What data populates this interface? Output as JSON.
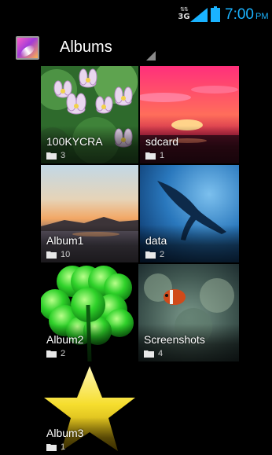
{
  "status_bar": {
    "network_type": "3G",
    "time": "7:00",
    "ampm": "PM",
    "time_color": "#1ab3ff",
    "icons": [
      "network-activity-icon",
      "signal-icon",
      "battery-icon"
    ]
  },
  "action_bar": {
    "title": "Albums",
    "app_icon": "gallery-icon"
  },
  "albums": [
    {
      "name": "100KYCRA",
      "count": "3"
    },
    {
      "name": "sdcard",
      "count": "1"
    },
    {
      "name": "Album1",
      "count": "10"
    },
    {
      "name": "data",
      "count": "2"
    },
    {
      "name": "Album2",
      "count": "2"
    },
    {
      "name": "Screenshots",
      "count": "4"
    },
    {
      "name": "Album3",
      "count": "1"
    }
  ]
}
